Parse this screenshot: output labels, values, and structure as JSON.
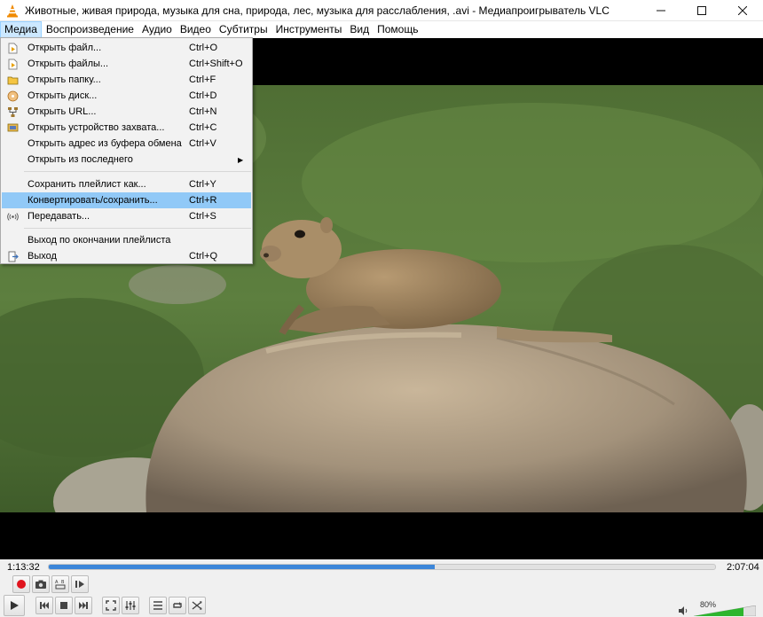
{
  "window": {
    "title": "Животные, живая природа, музыка для сна, природа, лес, музыка для расслабления, .avi - Медиапроигрыватель VLC",
    "app_icon": "vlc-cone-icon"
  },
  "menubar": {
    "items": [
      "Медиа",
      "Воспроизведение",
      "Аудио",
      "Видео",
      "Субтитры",
      "Инструменты",
      "Вид",
      "Помощь"
    ],
    "active": "Медиа"
  },
  "media_menu": {
    "items": [
      {
        "label": "Открыть файл...",
        "shortcut": "Ctrl+O",
        "icon": "file-play-icon"
      },
      {
        "label": "Открыть файлы...",
        "shortcut": "Ctrl+Shift+O",
        "icon": "files-icon"
      },
      {
        "label": "Открыть папку...",
        "shortcut": "Ctrl+F",
        "icon": "folder-icon"
      },
      {
        "label": "Открыть диск...",
        "shortcut": "Ctrl+D",
        "icon": "disc-icon"
      },
      {
        "label": "Открыть URL...",
        "shortcut": "Ctrl+N",
        "icon": "network-icon"
      },
      {
        "label": "Открыть устройство захвата...",
        "shortcut": "Ctrl+C",
        "icon": "capture-device-icon"
      },
      {
        "label": "Открыть адрес из буфера обмена",
        "shortcut": "Ctrl+V",
        "icon": ""
      },
      {
        "label": "Открыть из последнего",
        "shortcut": "",
        "icon": "",
        "submenu": true
      },
      {
        "label": "Сохранить плейлист как...",
        "shortcut": "Ctrl+Y",
        "icon": ""
      },
      {
        "label": "Конвертировать/сохранить...",
        "shortcut": "Ctrl+R",
        "icon": "",
        "highlighted": true
      },
      {
        "label": "Передавать...",
        "shortcut": "Ctrl+S",
        "icon": "stream-icon"
      },
      {
        "label": "Выход по окончании плейлиста",
        "shortcut": "",
        "icon": ""
      },
      {
        "label": "Выход",
        "shortcut": "Ctrl+Q",
        "icon": "exit-icon"
      }
    ]
  },
  "player": {
    "elapsed": "1:13:32",
    "total": "2:07:04",
    "progress": 0.579,
    "volume_label": "80%",
    "volume": 0.8
  },
  "colors": {
    "highlight": "#91c9f7",
    "seek_fill": "#3c86d9",
    "record": "#e0141e",
    "volume": "#2db52d"
  }
}
